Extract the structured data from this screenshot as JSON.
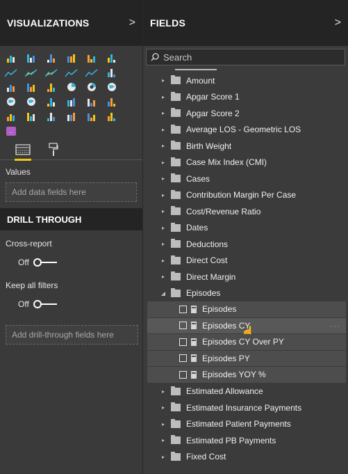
{
  "visualizations": {
    "title": "VISUALIZATIONS",
    "chevron": ">",
    "icon_rows": [
      [
        "stacked-bar-icon",
        "stacked-column-icon",
        "clustered-bar-icon",
        "clustered-column-icon",
        "100-bar-icon",
        "100-column-icon"
      ],
      [
        "line-chart-icon",
        "area-chart-icon",
        "stacked-area-icon",
        "line-column-icon",
        "line-clustered-column-icon",
        "ribbon-chart-icon"
      ],
      [
        "waterfall-icon",
        "funnel-icon",
        "scatter-icon",
        "pie-icon",
        "donut-icon",
        "treemap-icon"
      ],
      [
        "map-icon",
        "filled-map-icon",
        "gauge-icon",
        "card-icon",
        "multirow-card-icon",
        "kpi-icon"
      ],
      [
        "slicer-icon",
        "table-icon",
        "matrix-icon",
        "r-visual-icon",
        "arcgis-icon",
        "custom-visual-icon"
      ],
      [
        "more-visuals-icon"
      ]
    ],
    "values_label": "Values",
    "values_placeholder": "Add data fields here"
  },
  "drill_through": {
    "title": "DRILL THROUGH",
    "cross_report_label": "Cross-report",
    "cross_report_state": "Off",
    "keep_filters_label": "Keep all filters",
    "keep_filters_state": "Off",
    "drop_placeholder": "Add drill-through fields here"
  },
  "fields": {
    "title": "FIELDS",
    "chevron": ">",
    "search_placeholder": "Search",
    "items": [
      {
        "label": "Amount"
      },
      {
        "label": "Apgar Score 1"
      },
      {
        "label": "Apgar Score 2"
      },
      {
        "label": "Average LOS - Geometric LOS"
      },
      {
        "label": "Birth Weight"
      },
      {
        "label": "Case Mix Index (CMI)"
      },
      {
        "label": "Cases"
      },
      {
        "label": "Contribution Margin Per Case"
      },
      {
        "label": "Cost/Revenue Ratio"
      },
      {
        "label": "Dates"
      },
      {
        "label": "Deductions"
      },
      {
        "label": "Direct Cost"
      },
      {
        "label": "Direct Margin"
      },
      {
        "label": "Episodes"
      }
    ],
    "episodes_children": [
      {
        "label": "Episodes"
      },
      {
        "label": "Episodes CY"
      },
      {
        "label": "Episodes CY Over PY"
      },
      {
        "label": "Episodes PY"
      },
      {
        "label": "Episodes YOY %"
      }
    ],
    "items_after": [
      {
        "label": "Estimated Allowance"
      },
      {
        "label": "Estimated Insurance Payments"
      },
      {
        "label": "Estimated Patient Payments"
      },
      {
        "label": "Estimated PB Payments"
      },
      {
        "label": "Fixed Cost"
      }
    ],
    "more_label": "···"
  },
  "colors": {
    "accent": "#f2c811",
    "pane_bg": "#3a3a3a",
    "header_bg": "#242424"
  }
}
